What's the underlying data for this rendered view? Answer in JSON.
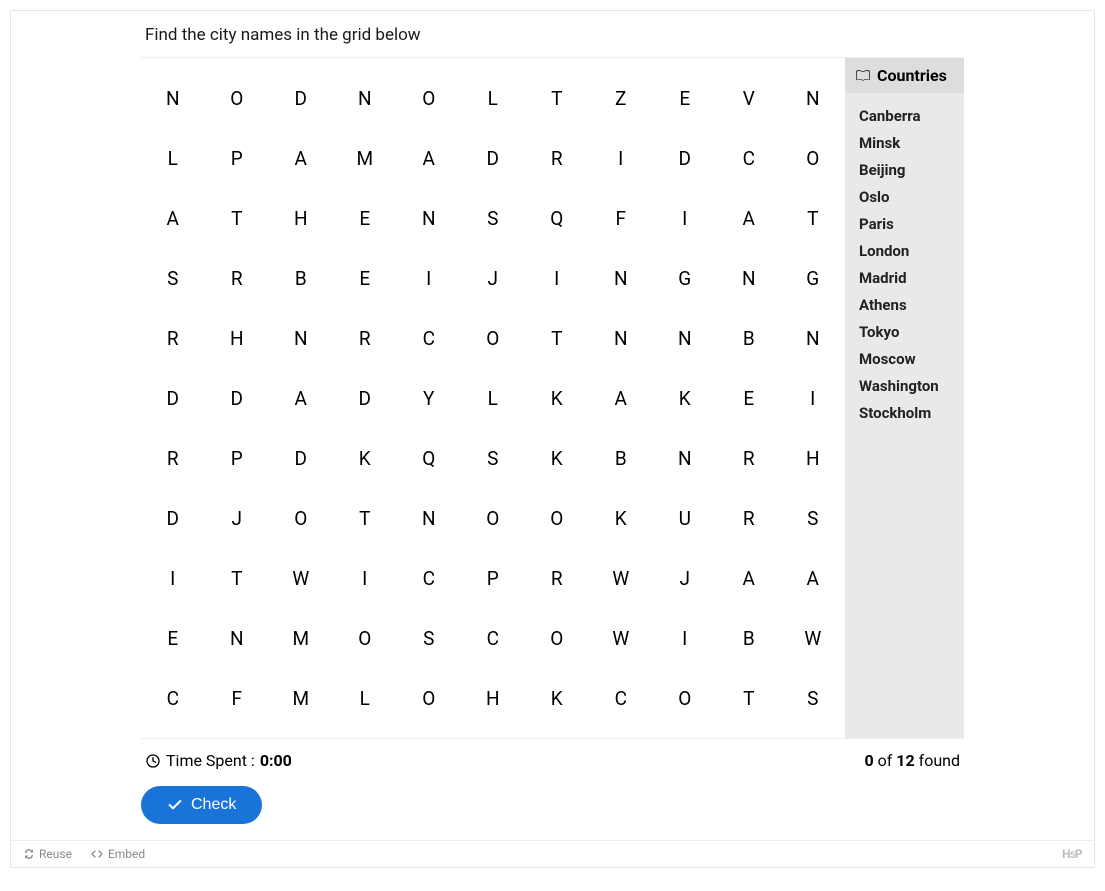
{
  "instruction": "Find the city names in the grid below",
  "grid": [
    [
      "N",
      "O",
      "D",
      "N",
      "O",
      "L",
      "T",
      "Z",
      "E",
      "V",
      "N"
    ],
    [
      "L",
      "P",
      "A",
      "M",
      "A",
      "D",
      "R",
      "I",
      "D",
      "C",
      "O"
    ],
    [
      "A",
      "T",
      "H",
      "E",
      "N",
      "S",
      "Q",
      "F",
      "I",
      "A",
      "T"
    ],
    [
      "S",
      "R",
      "B",
      "E",
      "I",
      "J",
      "I",
      "N",
      "G",
      "N",
      "G"
    ],
    [
      "R",
      "H",
      "N",
      "R",
      "C",
      "O",
      "T",
      "N",
      "N",
      "B",
      "N"
    ],
    [
      "D",
      "D",
      "A",
      "D",
      "Y",
      "L",
      "K",
      "A",
      "K",
      "E",
      "I"
    ],
    [
      "R",
      "P",
      "D",
      "K",
      "Q",
      "S",
      "K",
      "B",
      "N",
      "R",
      "H"
    ],
    [
      "D",
      "J",
      "O",
      "T",
      "N",
      "O",
      "O",
      "K",
      "U",
      "R",
      "S"
    ],
    [
      "I",
      "T",
      "W",
      "I",
      "C",
      "P",
      "R",
      "W",
      "J",
      "A",
      "A"
    ],
    [
      "E",
      "N",
      "M",
      "O",
      "S",
      "C",
      "O",
      "W",
      "I",
      "B",
      "W"
    ],
    [
      "C",
      "F",
      "M",
      "L",
      "O",
      "H",
      "K",
      "C",
      "O",
      "T",
      "S"
    ]
  ],
  "sidebar": {
    "title": "Countries",
    "items": [
      "Canberra",
      "Minsk",
      "Beijing",
      "Oslo",
      "Paris",
      "London",
      "Madrid",
      "Athens",
      "Tokyo",
      "Moscow",
      "Washington",
      "Stockholm"
    ]
  },
  "timer": {
    "label": "Time Spent : ",
    "value": "0:00"
  },
  "found": {
    "count": "0",
    "sep": " of ",
    "total": "12",
    "suffix": " found"
  },
  "buttons": {
    "check": "Check"
  },
  "footer": {
    "reuse": "Reuse",
    "embed": "Embed",
    "logo": "H5P"
  }
}
